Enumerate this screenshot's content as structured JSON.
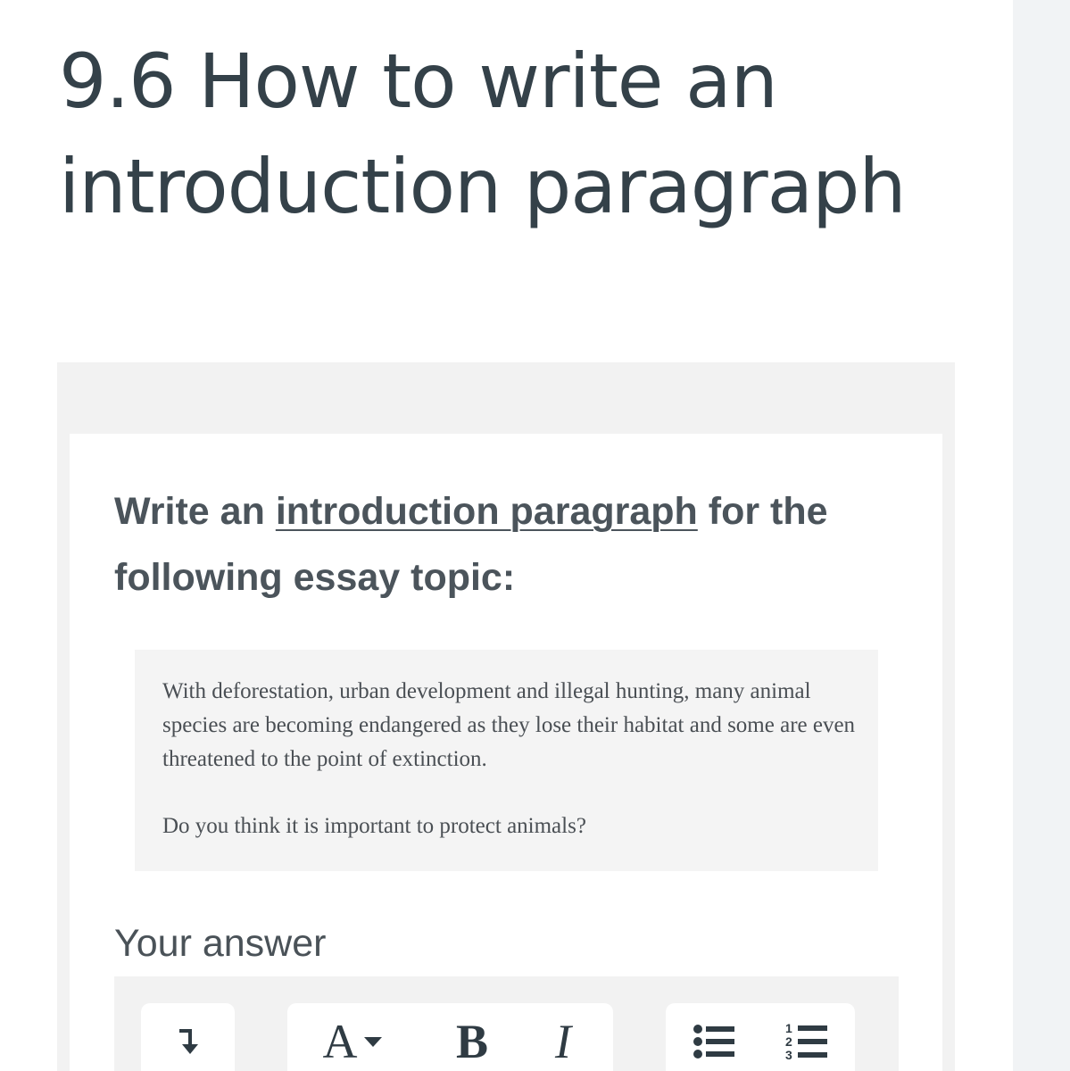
{
  "page": {
    "title": "9.6 How to write an introduction paragraph"
  },
  "question": {
    "prompt_before": "Write an ",
    "prompt_link": "introduction paragraph",
    "prompt_after": " for the following essay topic:",
    "passage": "With deforestation, urban development and illegal hunting, many animal species are becoming endangered as they lose their habitat and some are even threatened to the point of extinction.",
    "passage_question": "Do you think it is important to protect animals?"
  },
  "answer": {
    "label": "Your answer"
  },
  "toolbar": {
    "font_label": "A",
    "bold_label": "B",
    "italic_label": "I",
    "icons": [
      "indent-arrow-icon",
      "chevron-down-icon",
      "bulleted-list-icon",
      "numbered-list-icon"
    ]
  },
  "colors": {
    "title_text": "#344149",
    "body_text": "#4b545b",
    "panel_bg": "#f2f2f2",
    "quote_bg": "#f4f4f4",
    "sidebar_bg": "#f1f3f5"
  }
}
